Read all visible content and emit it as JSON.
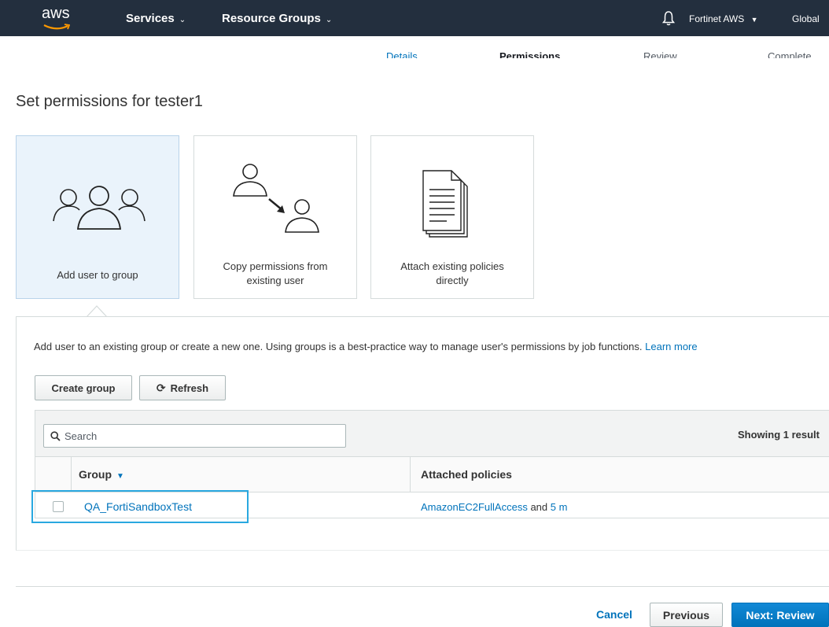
{
  "nav": {
    "logo": "aws",
    "services": "Services",
    "resource_groups": "Resource Groups",
    "account": "Fortinet AWS",
    "region": "Global",
    "bell_icon": "bell-icon"
  },
  "steps": [
    {
      "label": "Details"
    },
    {
      "label": "Permissions"
    },
    {
      "label": "Review"
    },
    {
      "label": "Complete"
    }
  ],
  "page": {
    "title": "Set permissions for tester1"
  },
  "options": [
    {
      "label": "Add user to group",
      "icon": "users-group-icon",
      "selected": true
    },
    {
      "label_line1": "Copy permissions from",
      "label_line2": "existing user",
      "icon": "copy-user-icon"
    },
    {
      "label_line1": "Attach existing policies",
      "label_line2": "directly",
      "icon": "document-stack-icon"
    }
  ],
  "panel": {
    "description": "Add user to an existing group or create a new one. Using groups is a best-practice way to manage user's permissions by job functions.",
    "learn_more": "Learn more",
    "create_group": "Create group",
    "refresh": "Refresh",
    "search_placeholder": "Search",
    "showing": "Showing 1 result",
    "columns": {
      "group": "Group",
      "policies": "Attached policies"
    },
    "rows": [
      {
        "group": "QA_FortiSandboxTest",
        "policy_link": "AmazonEC2FullAccess",
        "policy_and": "and",
        "policy_more": "5 m"
      }
    ]
  },
  "footer": {
    "cancel": "Cancel",
    "previous": "Previous",
    "next": "Next: Review"
  },
  "colors": {
    "nav_bg": "#232f3e",
    "link": "#0073bb",
    "selected_card_bg": "#eaf3fb",
    "primary_button": "#0073bb",
    "highlight_box": "#29a8e0"
  }
}
